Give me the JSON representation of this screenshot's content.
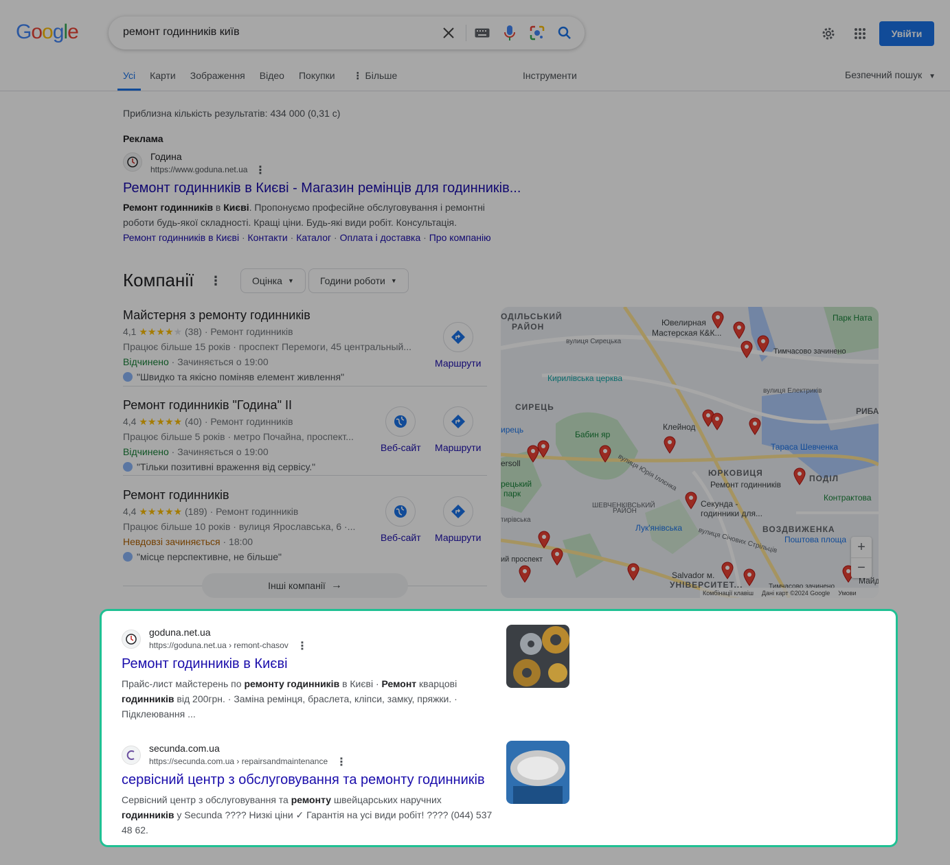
{
  "logo": {
    "letters": [
      "G",
      "o",
      "o",
      "g",
      "l",
      "e"
    ],
    "colors": [
      "#4285f4",
      "#ea4335",
      "#fbbc05",
      "#4285f4",
      "#34a853",
      "#ea4335"
    ]
  },
  "search": {
    "query": "ремонт годинників київ"
  },
  "header": {
    "signin_label": "Увійти"
  },
  "tabs": {
    "items": [
      {
        "label": "Усі"
      },
      {
        "label": "Карти"
      },
      {
        "label": "Зображення"
      },
      {
        "label": "Відео"
      },
      {
        "label": "Покупки"
      },
      {
        "label": "Більше"
      }
    ],
    "tools": "Інструменти",
    "safesearch": "Безпечний пошук"
  },
  "stats": "Приблизна кількість результатів: 434 000 (0,31 с)",
  "ad": {
    "label": "Реклама",
    "site_name": "Година",
    "url": "https://www.goduna.net.ua",
    "title": "Ремонт годинників в Києві - Магазин ремінців для годинників...",
    "snippet_bold1": "Ремонт годинників",
    "snippet_mid1": " в ",
    "snippet_bold2": "Києві",
    "snippet_rest": ". Пропонуємо професійне обслуговування і ремонтні",
    "snippet_line2": "роботи будь-якої складності. Кращі ціни. Будь-які види робіт. Консультація.",
    "sitelinks": [
      "Ремонт годинників в Києві",
      "Контакти",
      "Каталог",
      "Оплата і доставка",
      "Про компанію"
    ]
  },
  "companies": {
    "heading": "Компанії",
    "filters": [
      "Оцінка",
      "Години роботи"
    ],
    "more_label": "Інші компанії",
    "items": [
      {
        "name": "Майстерня з ремонту годинників",
        "rating": "4,1",
        "stars": "★★★★★",
        "reviews": "(38)",
        "category": "· Ремонт годинників",
        "desc": "Працює більше 15 років · проспект Перемоги, 45 центральный...",
        "status": "Відчинено",
        "hours": " · Зачиняється о 19:00",
        "review": "\"Швидко та якісно поміняв елемент живлення\"",
        "directions_label": "Маршрути"
      },
      {
        "name": "Ремонт годинників \"Година\" II",
        "rating": "4,4",
        "stars": "★★★★★",
        "reviews": "(40)",
        "category": "· Ремонт годинників",
        "desc": "Працює більше 5 років · метро Почайна, проспект...",
        "status": "Відчинено",
        "hours": " · Зачиняється о 19:00",
        "review": "\"Тільки позитивні враження від сервісу.\"",
        "website_label": "Веб-сайт",
        "directions_label": "Маршрути"
      },
      {
        "name": "Ремонт годинників",
        "rating": "4,4",
        "stars": "★★★★★",
        "reviews": "(189)",
        "category": "· Ремонт годинників",
        "desc": "Працює більше 10 років · вулиця Ярославська, 6 ·...",
        "status": "Невдовзі зачиняється",
        "hours": " · 18:00",
        "review": "\"місце перспективне, не більше\"",
        "website_label": "Веб-сайт",
        "directions_label": "Маршрути"
      }
    ]
  },
  "map": {
    "labels": {
      "podil_district": "ОДІЛЬСЬКИЙ",
      "raion": "РАЙОН",
      "jewelry": "Ювелирная",
      "jewelry2": "Мастерская К&К...",
      "park_nat": "Парк Ната",
      "temp_closed1": "Тимчасово зачинено",
      "syretska": "вулиця Сирецька",
      "kyryliv": "Кирилівська церква",
      "elektrykiv": "вулиця Електриків",
      "syrets": "СИРЕЦЬ",
      "babyn": "Бабин яр",
      "kleynod": "Клейнод",
      "ryba": "РИБА",
      "taras": "Тараса Шевченка",
      "yurkovytsia": "ЮРКОВИЦЯ",
      "podil": "ПОДІЛ",
      "remont": "Ремонт годинників",
      "kontraktova": "Контрактова",
      "irets": "ирець",
      "gersoll": "ersoll",
      "park": "рецький",
      "park2": "парк",
      "illenka": "вулиця Юрія Іллєнка",
      "shevchenk": "ШЕВЧЕНКІВСЬКИЙ",
      "shevchenk2": "РАЙОН",
      "sekunda": "Секунда -",
      "sekunda2": "годинники для...",
      "lukyan": "Лук'янівська",
      "vozdvyzh": "ВОЗДВИЖЕНКА",
      "poshtova": "Поштова площа",
      "tyrasp": "тирівська",
      "sichovykh": "вулиця Січових Стрільців",
      "prospekt": "ий проспект",
      "salvador": "Salvador м.",
      "univ": "УНІВЕРСИТЕТ...",
      "temp_closed2": "Тимчасово зачинено",
      "maid": "Майд",
      "keys": "Комбінації клавіш",
      "mapdata": "Дані карт ©2024 Google",
      "terms": "Умови"
    }
  },
  "results": [
    {
      "site_name": "goduna.net.ua",
      "breadcrumb": "https://goduna.net.ua › remont-chasov",
      "title": "Ремонт годинників в Києві",
      "s1": "Прайс-лист майстерень по ",
      "b1": "ремонту годинників",
      "s2": " в Києві · ",
      "b2": "Ремонт",
      "s3": " кварцові",
      "b3": "годинників",
      "s4": " від 200грн. · Заміна ремінця, браслета, кліпси, замку, пряжки. ·",
      "s5": "Підклеювання ..."
    },
    {
      "site_name": "secunda.com.ua",
      "breadcrumb": "https://secunda.com.ua › repairsandmaintenance",
      "title": "сервісний центр з обслуговування та ремонту годинників",
      "s1": "Сервісний центр з обслуговування та ",
      "b1": "ремонту",
      "s2": " швейцарських наручних",
      "b2": "годинників",
      "s3": " у Secunda ???? Низкі ціни ✓ Гарантія на усі види робіт! ???? (044) 537",
      "s4": "48 62."
    }
  ]
}
